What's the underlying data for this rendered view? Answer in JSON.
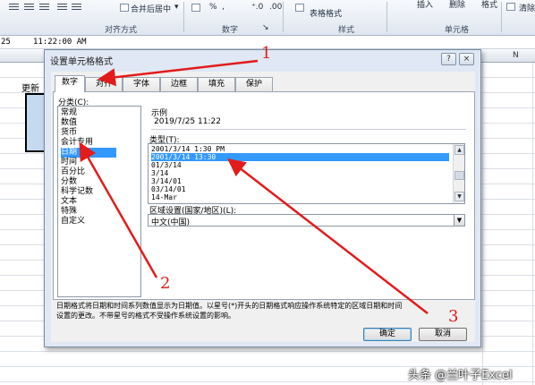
{
  "ribbon": {
    "merge_center": "合并后居中",
    "table_format": "表格格式",
    "insert_label": "插入",
    "delete_label": "删除",
    "format_label": "格式",
    "clear_label": "清除",
    "group_alignment": "对齐方式",
    "group_number": "数字",
    "group_styles": "样式",
    "group_cells": "单元格"
  },
  "formula_bar": {
    "ref": "25",
    "value": "11:22:00 AM"
  },
  "sheet": {
    "col_right": "N",
    "cell_text": "更新"
  },
  "dialog": {
    "title": "设置单元格格式",
    "help_label": "?",
    "close_label": "×",
    "tabs": [
      "数字",
      "对齐",
      "字体",
      "边框",
      "填充",
      "保护"
    ],
    "active_tab": 0,
    "category_label": "分类(C):",
    "categories": [
      "常规",
      "数值",
      "货币",
      "会计专用",
      "日期",
      "时间",
      "百分比",
      "分数",
      "科学记数",
      "文本",
      "特殊",
      "自定义"
    ],
    "selected_category": 4,
    "sample_label": "示例",
    "sample_value": "2019/7/25 11:22",
    "type_label": "类型(T):",
    "types": [
      "2001/3/14 1:30 PM",
      "2001/3/14 13:30",
      "01/3/14",
      "3/14",
      "3/14/01",
      "03/14/01",
      "14-Mar"
    ],
    "selected_type": 1,
    "locale_label": "区域设置(国家/地区)(L):",
    "locale_value": "中文(中国)",
    "description_line1": "日期格式将日期和时间系列数值显示为日期值。以星号(*)开头的日期格式响应操作系统特定的区域日期和时间",
    "description_line2": "设置的更改。不带星号的格式不受操作系统设置的影响。",
    "ok_label": "确定",
    "cancel_label": "取消"
  },
  "annotations": {
    "colors": {
      "arrow": "#e21b1b"
    },
    "markers": [
      "1",
      "2",
      "3"
    ]
  },
  "watermark": "头条 @兰叶子Excel"
}
